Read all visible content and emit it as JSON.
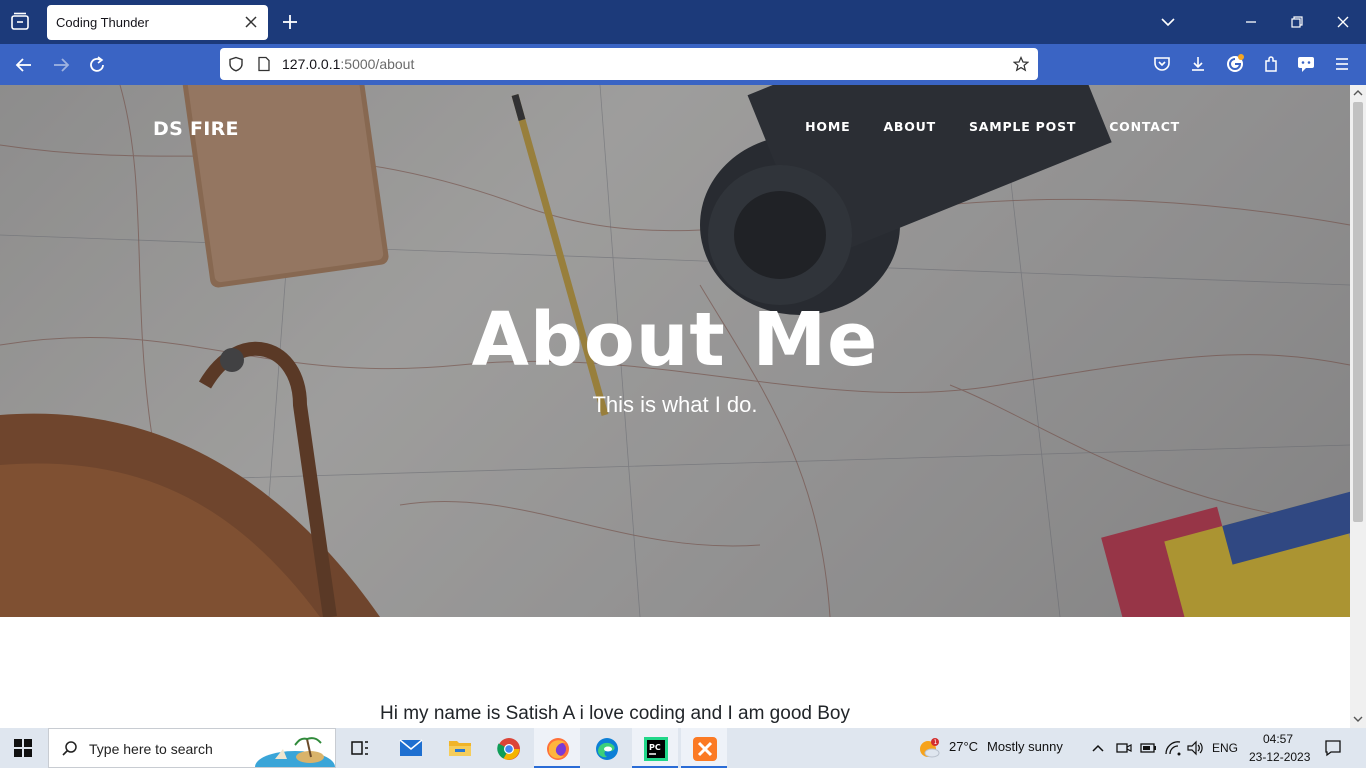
{
  "browser": {
    "tab_title": "Coding Thunder",
    "url_host": "127.0.0.1",
    "url_path": ":5000/about"
  },
  "site": {
    "brand": "DS FIRE",
    "nav": [
      "HOME",
      "ABOUT",
      "SAMPLE POST",
      "CONTACT"
    ]
  },
  "hero": {
    "title": "About Me",
    "subtitle": "This is what I do."
  },
  "content": {
    "paragraph": "Hi my name is Satish A i love coding and I am good Boy"
  },
  "taskbar": {
    "search_placeholder": "Type here to search",
    "weather_temp": "27°C",
    "weather_text": "Mostly sunny",
    "weather_badge": "1",
    "language": "ENG",
    "time": "04:57",
    "date": "23-12-2023"
  },
  "colors": {
    "tabbar_bg": "#1c3a7a",
    "navbar_bg": "#3a64c4",
    "taskbar_bg": "#dfe6ef",
    "active_indicator": "#2a6cd6"
  }
}
